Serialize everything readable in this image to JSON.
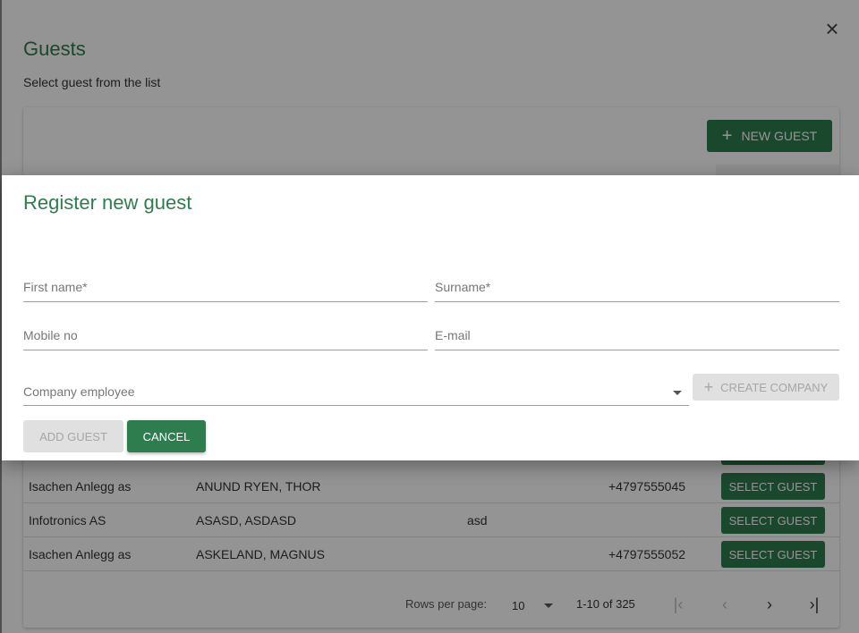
{
  "guests_dialog": {
    "title": "Guests",
    "subtitle": "Select guest from the list",
    "new_guest_label": "NEW GUEST",
    "rows": [
      {
        "company": "Isachen Anlegg as",
        "name": "ANUND RYEN, THOR",
        "email": "",
        "mobile": "+4797555045",
        "action": "SELECT GUEST"
      },
      {
        "company": "Infotronics AS",
        "name": "ASASD, ASDASD",
        "email": "asd",
        "mobile": "",
        "action": "SELECT GUEST"
      },
      {
        "company": "Isachen Anlegg as",
        "name": "ASKELAND, MAGNUS",
        "email": "",
        "mobile": "+4797555052",
        "action": "SELECT GUEST"
      }
    ],
    "pagination": {
      "rows_per_page_label": "Rows per page:",
      "rows_per_page": "10",
      "range": "1-10 of 325"
    }
  },
  "register_dialog": {
    "title": "Register new guest",
    "first_name_placeholder": "First name*",
    "surname_placeholder": "Surname*",
    "mobile_placeholder": "Mobile no",
    "email_placeholder": "E-mail",
    "company_placeholder": "Company employee",
    "create_company_label": "CREATE COMPANY",
    "add_guest_label": "ADD GUEST",
    "cancel_label": "CANCEL"
  },
  "colors": {
    "primary": "#2e7d4f",
    "disabled_bg": "#e0e0e0",
    "disabled_text": "#a6a6a6"
  }
}
